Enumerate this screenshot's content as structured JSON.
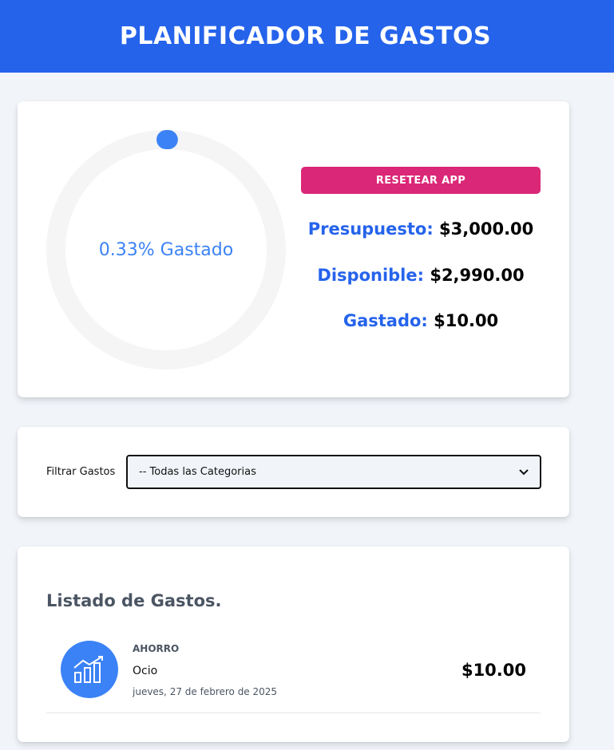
{
  "header": {
    "title": "PLANIFICADOR DE GASTOS"
  },
  "budget": {
    "percent_spent": 0.33,
    "progress_text": "0.33% Gastado",
    "reset_label": "RESETEAR APP",
    "presupuesto_label": "Presupuesto:",
    "presupuesto_value": "$3,000.00",
    "disponible_label": "Disponible:",
    "disponible_value": "$2,990.00",
    "gastado_label": "Gastado:",
    "gastado_value": "$10.00",
    "colors": {
      "track": "#f5f5f5",
      "path": "#3b82f6",
      "text": "#3b82f6"
    }
  },
  "filter": {
    "label": "Filtrar Gastos",
    "selected": "-- Todas las Categorias"
  },
  "list": {
    "title": "Listado de Gastos.",
    "items": [
      {
        "category": "AHORRO",
        "name": "Ocio",
        "date": "jueves, 27 de febrero de 2025",
        "amount": "$10.00",
        "icon": "savings-chart-icon"
      }
    ]
  },
  "colors": {
    "header": "#2563eb",
    "accent": "#2563eb",
    "reset": "#db2777",
    "background": "#f1f4f9"
  }
}
